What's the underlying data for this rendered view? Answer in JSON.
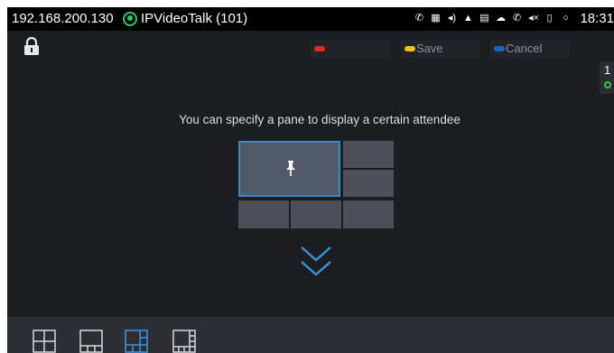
{
  "status_bar": {
    "ip_address": "192.168.200.130",
    "app_name": "IPVideoTalk (101)",
    "clock": "18:31",
    "icons": [
      "call-forward-icon",
      "voicemail-icon",
      "volume-icon",
      "wifi-icon",
      "sd-card-icon",
      "cloud-icon",
      "phone-icon",
      "mute-icon",
      "battery-icon",
      "sync-icon"
    ],
    "accent_color": "#32c96a"
  },
  "toolbar": {
    "softkeys": [
      {
        "label": "",
        "color": "#e8262b"
      },
      {
        "label": "Save",
        "color": "#f1c40f"
      },
      {
        "label": "Cancel",
        "color": "#1d62c9"
      }
    ]
  },
  "side_tab": {
    "count": "1"
  },
  "main": {
    "hint": "You can specify a pane to display a certain attendee",
    "selected_pane_color": "#3f88c8"
  },
  "bottom_bar": {
    "layouts": [
      "layout-quad-icon",
      "layout-one-plus-three-icon",
      "layout-one-plus-five-icon",
      "layout-one-plus-seven-icon"
    ],
    "selected_index": 2
  }
}
